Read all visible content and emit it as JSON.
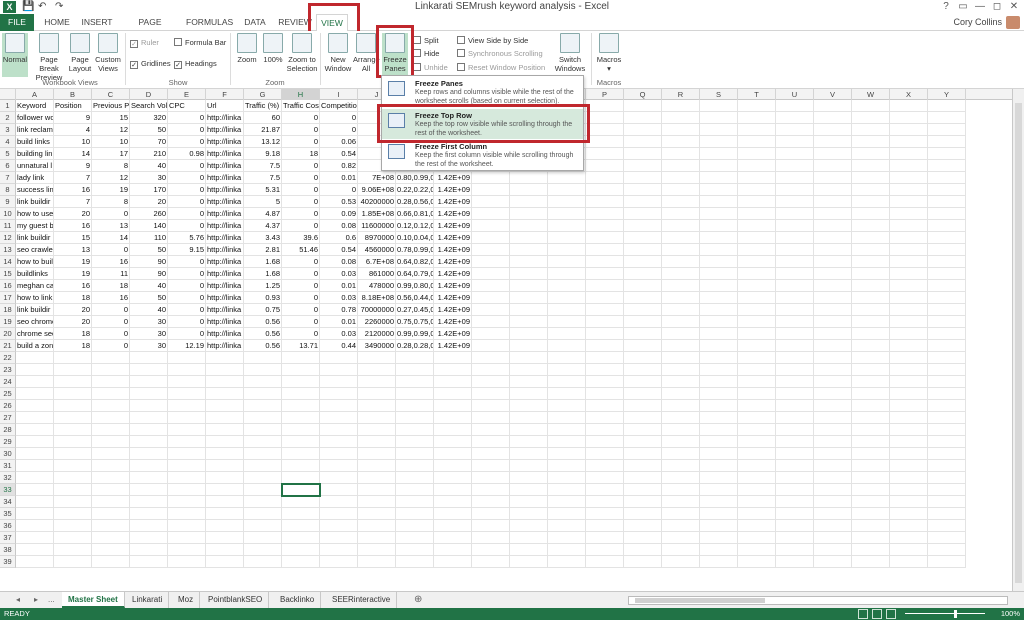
{
  "window": {
    "title": "Linkarati SEMrush keyword analysis - Excel",
    "logo": "X",
    "user_name": "Cory Collins",
    "controls": [
      "?",
      "▭",
      "—",
      "◻",
      "✕"
    ]
  },
  "qat": {
    "save": "💾",
    "undo": "↶",
    "redo": "↷"
  },
  "tabs": [
    "FILE",
    "HOME",
    "INSERT",
    "PAGE LAYOUT",
    "FORMULAS",
    "DATA",
    "REVIEW",
    "VIEW"
  ],
  "ribbon": {
    "workbook_views": {
      "label": "Workbook Views",
      "normal": "Normal",
      "page_break_1": "Page Break",
      "page_break_2": "Preview",
      "page_layout_1": "Page",
      "page_layout_2": "Layout",
      "custom_views_1": "Custom",
      "custom_views_2": "Views"
    },
    "show": {
      "label": "Show",
      "ruler": "Ruler",
      "formula_bar": "Formula Bar",
      "gridlines": "Gridlines",
      "headings": "Headings"
    },
    "zoom": {
      "label": "Zoom",
      "zoom": "Zoom",
      "zoom100": "100%",
      "zoom_sel_1": "Zoom to",
      "zoom_sel_2": "Selection"
    },
    "window": {
      "new_window_1": "New",
      "new_window_2": "Window",
      "arrange_1": "Arrange",
      "arrange_2": "All",
      "freeze_1": "Freeze",
      "freeze_2": "Panes ▾",
      "split": "Split",
      "hide": "Hide",
      "unhide": "Unhide",
      "side_by_side": "View Side by Side",
      "sync_scroll": "Synchronous Scrolling",
      "reset_pos": "Reset Window Position",
      "switch_1": "Switch",
      "switch_2": "Windows ▾"
    },
    "macros": {
      "label": "Macros",
      "macros_1": "Macros",
      "macros_2": "▾"
    }
  },
  "freeze_menu": [
    {
      "title": "Freeze Panes",
      "desc": "Keep rows and columns visible while the rest of the worksheet scrolls (based on current selection)."
    },
    {
      "title": "Freeze Top Row",
      "desc": "Keep the top row visible while scrolling through the rest of the worksheet."
    },
    {
      "title": "Freeze First Column",
      "desc": "Keep the first column visible while scrolling through the rest of the worksheet."
    }
  ],
  "columns": [
    "A",
    "B",
    "C",
    "D",
    "E",
    "F",
    "G",
    "H",
    "I",
    "J",
    "K",
    "L",
    "M",
    "N",
    "O",
    "P",
    "Q",
    "R",
    "S",
    "T",
    "U",
    "V",
    "W",
    "X",
    "Y"
  ],
  "rows": [
    [
      "Keyword",
      "Position",
      "Previous Po",
      "Search Volu",
      "CPC",
      "Url",
      "Traffic (%)",
      "Traffic Cost",
      "Competitio",
      "Nu",
      "",
      "",
      ""
    ],
    [
      "follower wo",
      "9",
      "15",
      "320",
      "0",
      "http://linka",
      "60",
      "0",
      "0",
      "2",
      "",
      "",
      ""
    ],
    [
      "link reclam",
      "4",
      "12",
      "50",
      "0",
      "http://linka",
      "21.87",
      "0",
      "0",
      "14",
      "",
      "",
      ""
    ],
    [
      "build links",
      "10",
      "10",
      "70",
      "0",
      "http://linka",
      "13.12",
      "0",
      "0.06",
      "6",
      "",
      "",
      ""
    ],
    [
      "building lin",
      "14",
      "17",
      "210",
      "0.98",
      "http://linka",
      "9.18",
      "18",
      "0.54",
      "1",
      "",
      "",
      ""
    ],
    [
      "unnatural l",
      "9",
      "8",
      "40",
      "0",
      "http://linka",
      "7.5",
      "0",
      "0.82",
      "4",
      "",
      "",
      ""
    ],
    [
      "lady link",
      "7",
      "12",
      "30",
      "0",
      "http://linka",
      "7.5",
      "0",
      "0.01",
      "7E+08",
      "0.80,0.99,0",
      "1.42E+09",
      ""
    ],
    [
      "success lin",
      "16",
      "19",
      "170",
      "0",
      "http://linka",
      "5.31",
      "0",
      "0",
      "9.06E+08",
      "0.22,0.22,0",
      "1.42E+09",
      ""
    ],
    [
      "link buildir",
      "7",
      "8",
      "20",
      "0",
      "http://linka",
      "5",
      "0",
      "0.53",
      "40200000",
      "0.28,0.56,0",
      "1.42E+09",
      ""
    ],
    [
      "how to use",
      "20",
      "0",
      "260",
      "0",
      "http://linka",
      "4.87",
      "0",
      "0.09",
      "1.85E+08",
      "0.66,0.81,0",
      "1.42E+09",
      ""
    ],
    [
      "my guest bl",
      "16",
      "13",
      "140",
      "0",
      "http://linka",
      "4.37",
      "0",
      "0.08",
      "11600000",
      "0.12,0.12,0",
      "1.42E+09",
      ""
    ],
    [
      "link buildir",
      "15",
      "14",
      "110",
      "5.76",
      "http://linka",
      "3.43",
      "39.6",
      "0.6",
      "8970000",
      "0.10,0.04,0",
      "1.42E+09",
      ""
    ],
    [
      "seo crawler",
      "13",
      "0",
      "50",
      "9.15",
      "http://linka",
      "2.81",
      "51.46",
      "0.54",
      "4560000",
      "0.78,0.99,0",
      "1.42E+09",
      ""
    ],
    [
      "how to buil",
      "19",
      "16",
      "90",
      "0",
      "http://linka",
      "1.68",
      "0",
      "0.08",
      "6.7E+08",
      "0.64,0.82,0",
      "1.42E+09",
      ""
    ],
    [
      "buildlinks",
      "19",
      "11",
      "90",
      "0",
      "http://linka",
      "1.68",
      "0",
      "0.03",
      "861000",
      "0.64,0.79,0",
      "1.42E+09",
      ""
    ],
    [
      "meghan cal",
      "16",
      "18",
      "40",
      "0",
      "http://linka",
      "1.25",
      "0",
      "0.01",
      "478000",
      "0.99,0.80,0",
      "1.42E+09",
      ""
    ],
    [
      "how to link",
      "18",
      "16",
      "50",
      "0",
      "http://linka",
      "0.93",
      "0",
      "0.03",
      "8.18E+08",
      "0.56,0.44,0",
      "1.42E+09",
      ""
    ],
    [
      "link buildir",
      "20",
      "0",
      "40",
      "0",
      "http://linka",
      "0.75",
      "0",
      "0.78",
      "70000000",
      "0.27,0.45,0",
      "1.42E+09",
      ""
    ],
    [
      "seo chrome",
      "20",
      "0",
      "30",
      "0",
      "http://linka",
      "0.56",
      "0",
      "0.01",
      "2260000",
      "0.75,0.75,0",
      "1.42E+09",
      ""
    ],
    [
      "chrome sec",
      "18",
      "0",
      "30",
      "0",
      "http://linka",
      "0.56",
      "0",
      "0.03",
      "2120000",
      "0.99,0.99,0",
      "1.42E+09",
      ""
    ],
    [
      "build a zon",
      "18",
      "0",
      "30",
      "12.19",
      "http://linka",
      "0.56",
      "13.71",
      "0.44",
      "3490000",
      "0.28,0.28,0",
      "1.42E+09",
      ""
    ]
  ],
  "row_count": 39,
  "selected_row": "33",
  "selected_col": "H",
  "sheets": [
    "Master Sheet",
    "Linkarati",
    "Moz",
    "PointblankSEO",
    "Backlinko",
    "SEERinteractive"
  ],
  "sheet_nav": [
    "◂",
    "▸",
    "...",
    "⊕"
  ],
  "status": {
    "ready": "READY",
    "zoom": "100%"
  }
}
